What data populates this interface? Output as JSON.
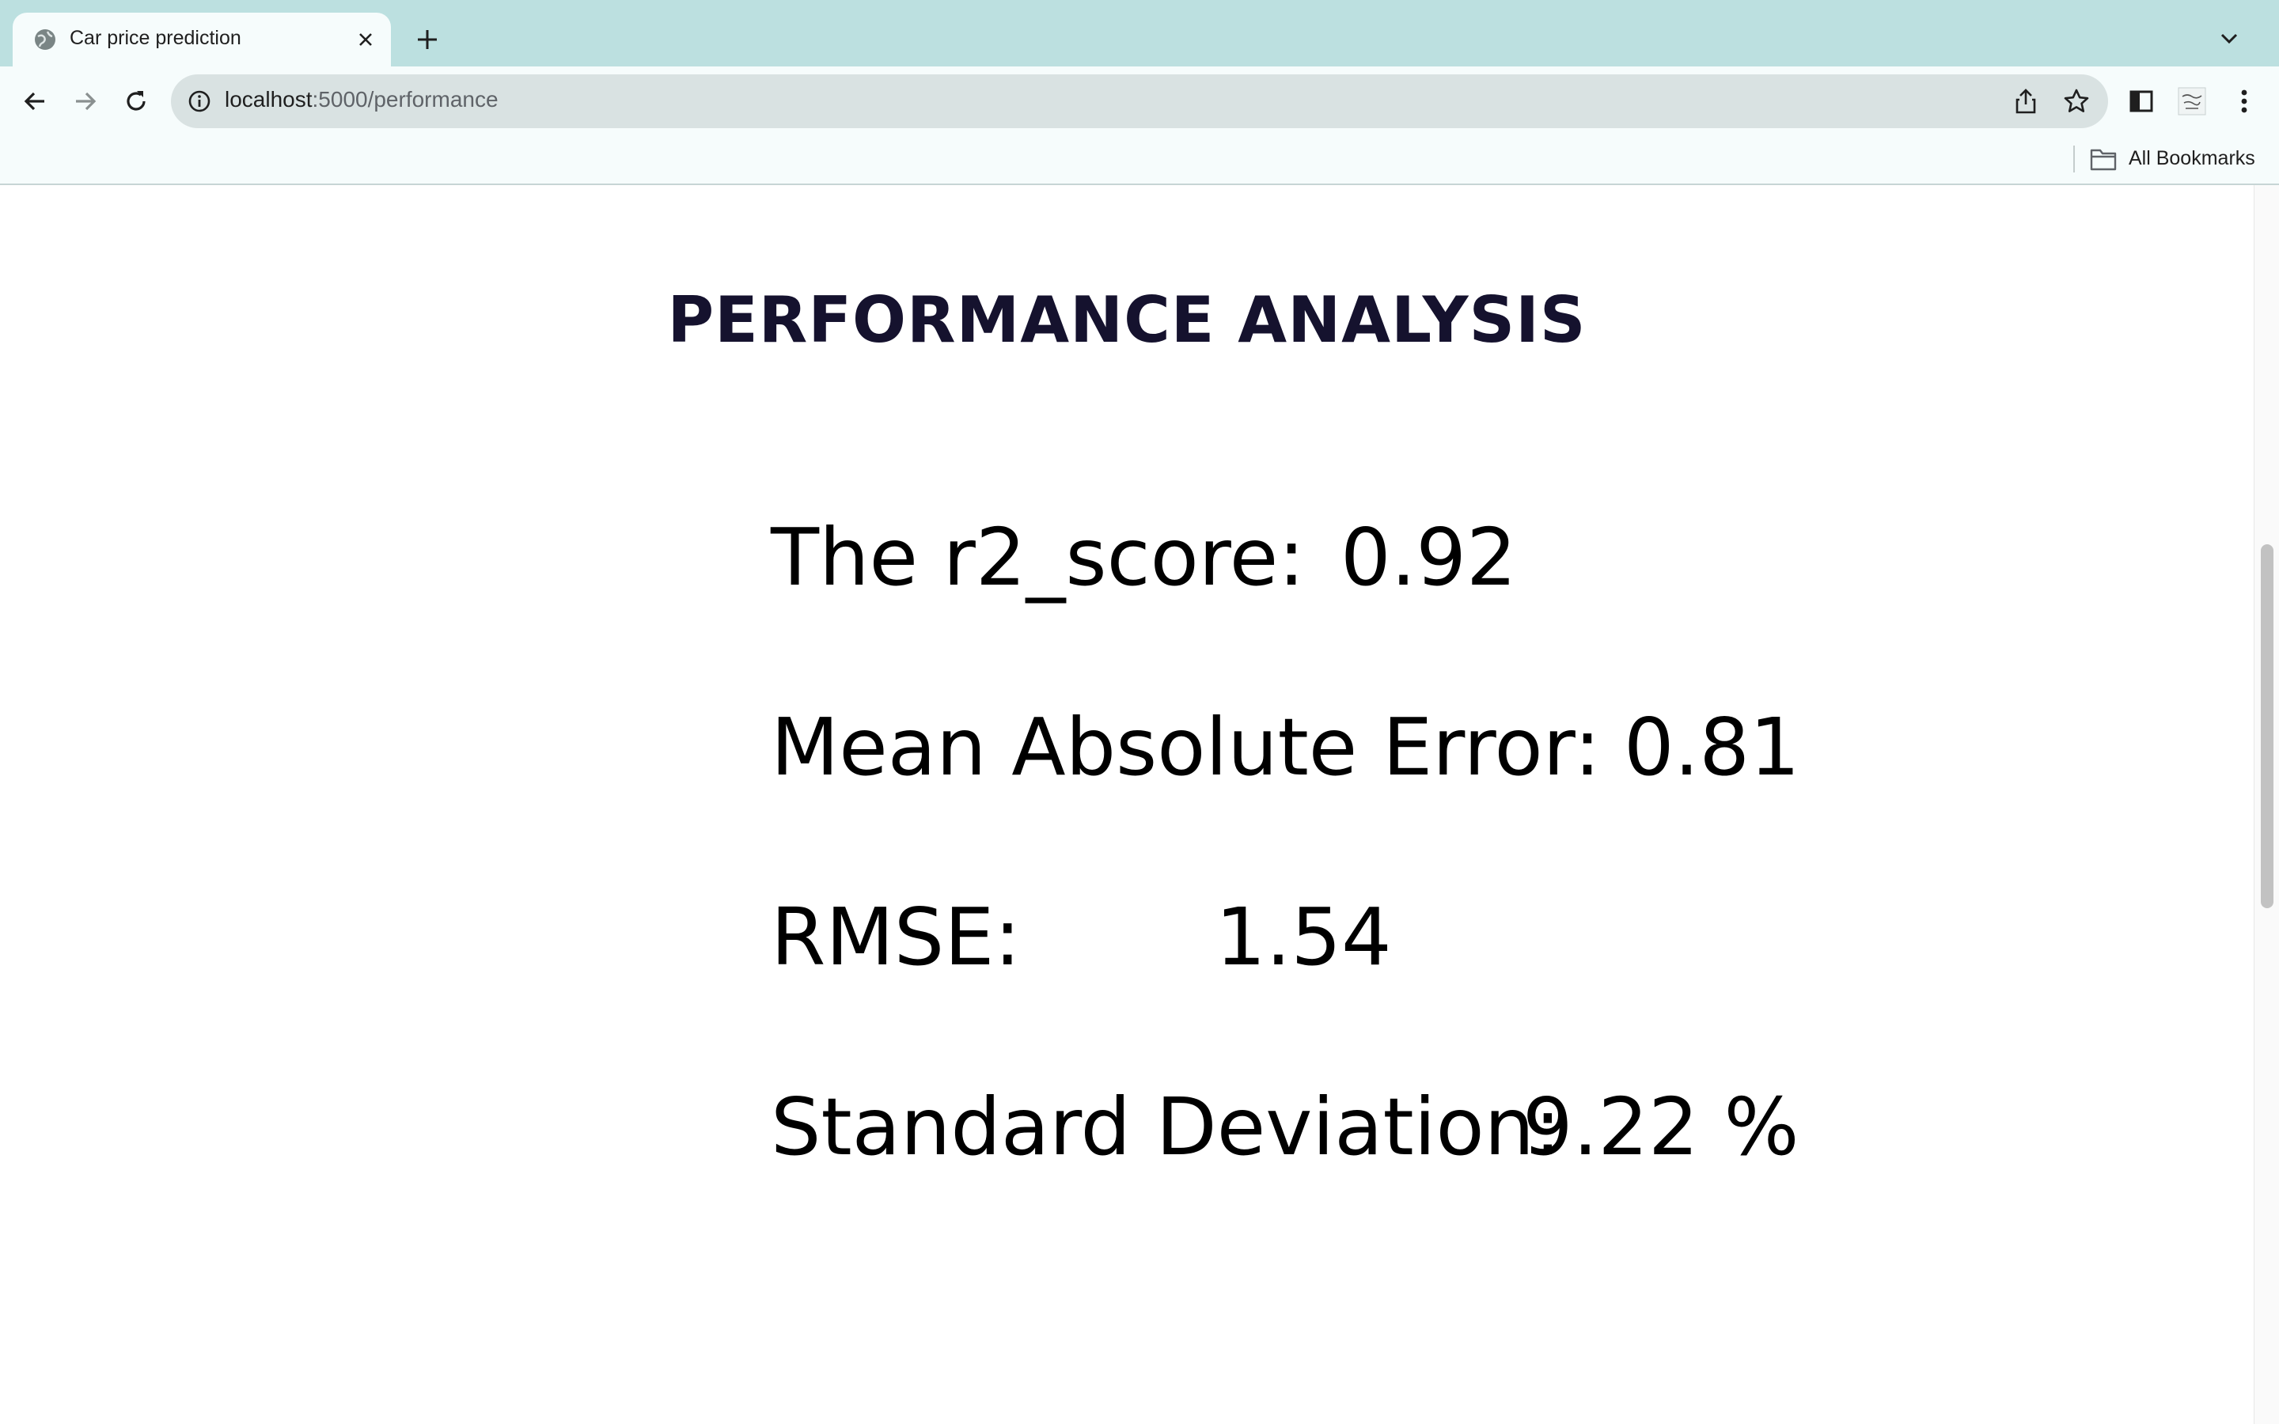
{
  "browser": {
    "tab": {
      "title": "Car price prediction",
      "favicon": "globe-icon"
    },
    "url": {
      "host": "localhost",
      "path": ":5000/performance"
    },
    "bookmarks_label": "All Bookmarks"
  },
  "page": {
    "title": "PERFORMANCE ANALYSIS",
    "metrics": [
      {
        "label": "The r2_score:",
        "value": "0.92"
      },
      {
        "label": "Mean Absolute Error:",
        "value": "0.81"
      },
      {
        "label": "RMSE:",
        "value": "1.54"
      },
      {
        "label": "Standard Deviation:",
        "value": "9.22 %"
      }
    ]
  },
  "colors": {
    "tabstrip": "#bce0e0",
    "toolbar": "#f6fcfc",
    "omnibox": "#d9e2e2",
    "title": "#15122e"
  }
}
